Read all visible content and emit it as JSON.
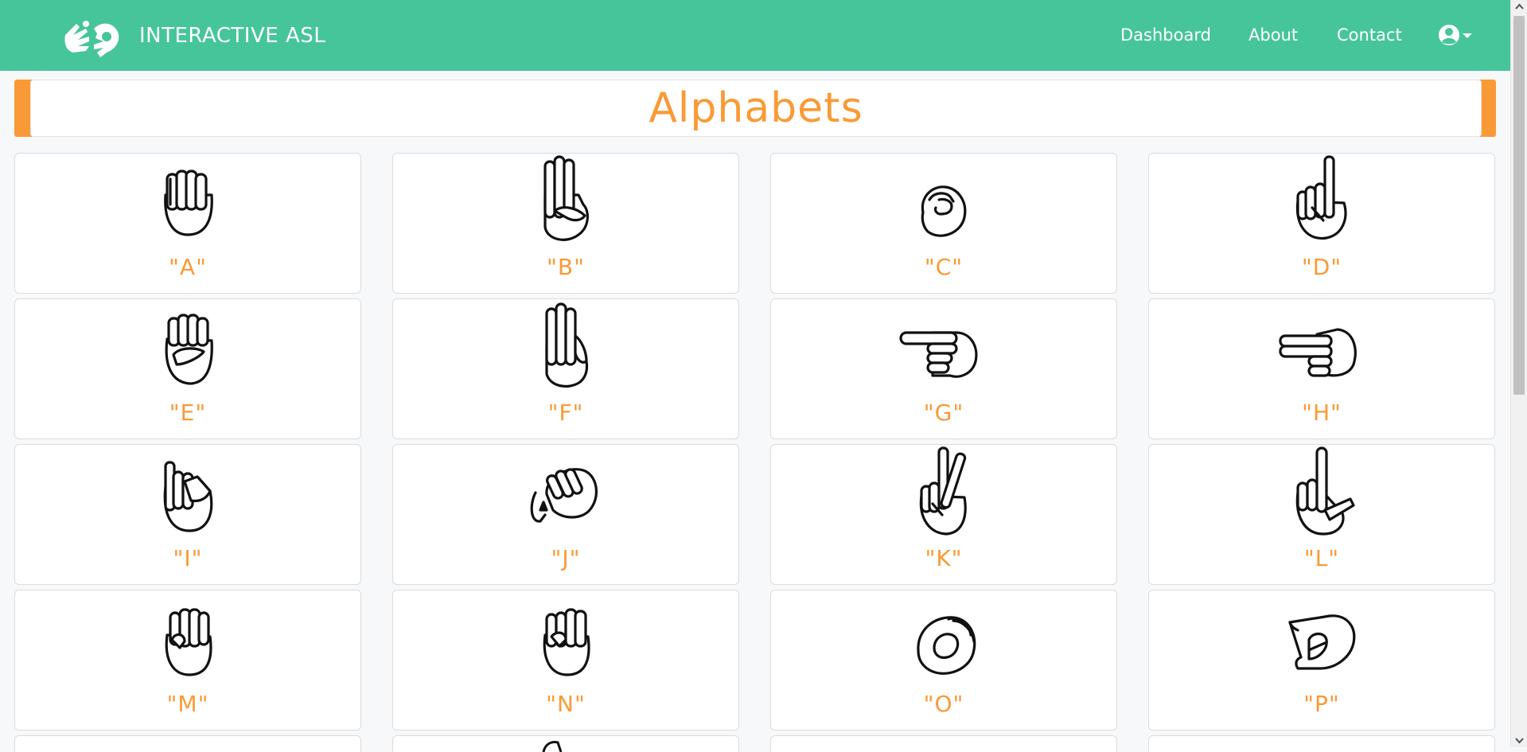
{
  "navbar": {
    "brand": "INTERACTIVE ASL",
    "links": [
      {
        "label": "Dashboard"
      },
      {
        "label": "About"
      },
      {
        "label": "Contact"
      }
    ],
    "user_icon": "user-circle-icon"
  },
  "section": {
    "title": "Alphabets"
  },
  "letters": [
    {
      "label": "\"A\"",
      "icon": "asl-a-hand-icon"
    },
    {
      "label": "\"B\"",
      "icon": "asl-b-hand-icon"
    },
    {
      "label": "\"C\"",
      "icon": "asl-c-hand-icon"
    },
    {
      "label": "\"D\"",
      "icon": "asl-d-hand-icon"
    },
    {
      "label": "\"E\"",
      "icon": "asl-e-hand-icon"
    },
    {
      "label": "\"F\"",
      "icon": "asl-f-hand-icon"
    },
    {
      "label": "\"G\"",
      "icon": "asl-g-hand-icon"
    },
    {
      "label": "\"H\"",
      "icon": "asl-h-hand-icon"
    },
    {
      "label": "\"I\"",
      "icon": "asl-i-hand-icon"
    },
    {
      "label": "\"J\"",
      "icon": "asl-j-hand-icon"
    },
    {
      "label": "\"K\"",
      "icon": "asl-k-hand-icon"
    },
    {
      "label": "\"L\"",
      "icon": "asl-l-hand-icon"
    },
    {
      "label": "\"M\"",
      "icon": "asl-m-hand-icon"
    },
    {
      "label": "\"N\"",
      "icon": "asl-n-hand-icon"
    },
    {
      "label": "\"O\"",
      "icon": "asl-o-hand-icon"
    },
    {
      "label": "\"P\"",
      "icon": "asl-p-hand-icon"
    }
  ],
  "colors": {
    "navbar": "#46c59b",
    "accent": "#f99a36",
    "page_background": "#f7f8fa"
  }
}
